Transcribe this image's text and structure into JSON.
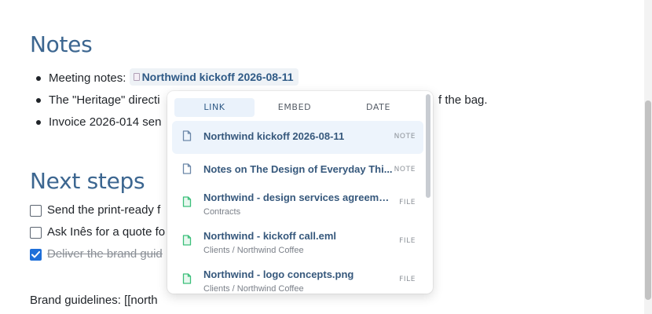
{
  "notes_section": {
    "heading": "Notes",
    "bullets": [
      {
        "prefix": "Meeting notes: ",
        "mention": "Northwind kickoff 2026-08-11"
      },
      {
        "text": "The \"Heritage\" directi",
        "tail": "f the bag."
      },
      {
        "text": "Invoice 2026-014 sen"
      }
    ]
  },
  "next_steps_section": {
    "heading": "Next steps",
    "tasks": [
      {
        "text": "Send the print-ready f",
        "checked": false
      },
      {
        "text": "Ask Inês for a quote fo",
        "checked": false
      },
      {
        "text": "Deliver the brand guid",
        "checked": true
      }
    ]
  },
  "brand_line": "Brand guidelines: [[north",
  "popover": {
    "tabs": [
      "LINK",
      "EMBED",
      "DATE"
    ],
    "active_tab": "LINK",
    "results": [
      {
        "title": "Northwind kickoff 2026-08-11",
        "subtitle": "",
        "kind": "NOTE",
        "icon": "note-icon",
        "selected": true
      },
      {
        "title": "Notes on The Design of Everyday Thi...",
        "subtitle": "",
        "kind": "NOTE",
        "icon": "note-icon",
        "selected": false
      },
      {
        "title": "Northwind - design services agreemen...",
        "subtitle": "Contracts",
        "kind": "FILE",
        "icon": "file-icon",
        "selected": false
      },
      {
        "title": "Northwind - kickoff call.eml",
        "subtitle": "Clients / Northwind Coffee",
        "kind": "FILE",
        "icon": "file-icon",
        "selected": false
      },
      {
        "title": "Northwind - logo concepts.png",
        "subtitle": "Clients / Northwind Coffee",
        "kind": "FILE",
        "icon": "file-icon",
        "selected": false
      }
    ]
  },
  "colors": {
    "heading": "#3c6690",
    "accent": "#1e6fd9",
    "file_icon": "#3bbf7a",
    "note_icon": "#6b87a8"
  }
}
